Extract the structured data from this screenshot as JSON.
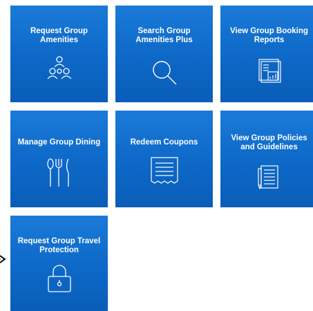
{
  "tiles": [
    {
      "label": "Request Group Amenities",
      "icon": "group-people-icon"
    },
    {
      "label": "Search Group Amenities Plus",
      "icon": "search-icon"
    },
    {
      "label": "View Group Booking Reports",
      "icon": "report-chart-icon"
    },
    {
      "label": "Manage Group Dining",
      "icon": "dining-utensils-icon"
    },
    {
      "label": "Redeem Coupons",
      "icon": "receipt-coupon-icon"
    },
    {
      "label": "View Group Policies and Guidelines",
      "icon": "document-pen-icon"
    },
    {
      "label": "Request Group Travel Protection",
      "icon": "lock-icon"
    }
  ],
  "colors": {
    "tile_top": "#1b7ad8",
    "tile_bottom": "#0a5db8",
    "text": "#ffffff",
    "pointer": "#111111"
  }
}
